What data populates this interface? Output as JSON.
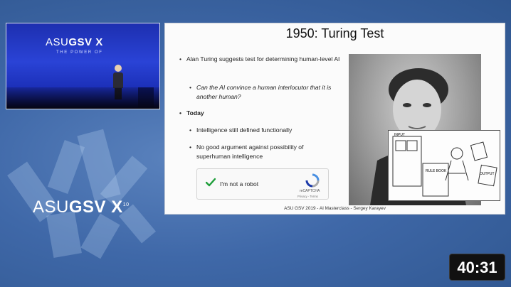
{
  "video": {
    "stage_title_light": "ASU",
    "stage_title_bold": "GSV",
    "stage_title_x": "X",
    "stage_subtitle": "THE POWER OF"
  },
  "slide": {
    "title": "1950: Turing Test",
    "bullets": {
      "b1": "Alan Turing suggests test for determining human-level AI",
      "b2": "Can the AI convince a human interlocutor that it is another human?",
      "b3": "Today",
      "b4": "Intelligence still defined functionally",
      "b5": "No good argument against possibility of superhuman intelligence"
    },
    "captcha": {
      "label": "I'm not a robot",
      "brand": "reCAPTCHA",
      "terms": "Privacy - Terms"
    },
    "sketch_labels": {
      "left": "INPUT",
      "mid": "RULE BOOK",
      "right": "OUTPUT"
    },
    "footer": "ASU GSV 2019 - AI Masterclass - Sergey Karayev"
  },
  "watermark": {
    "light": "ASU",
    "bold": "GSV",
    "x": "X",
    "sup": "10"
  },
  "duration": "40:31",
  "colors": {
    "background": "#3f68a8",
    "check": "#1e9e3a",
    "video_stage": "#2a43d6"
  }
}
